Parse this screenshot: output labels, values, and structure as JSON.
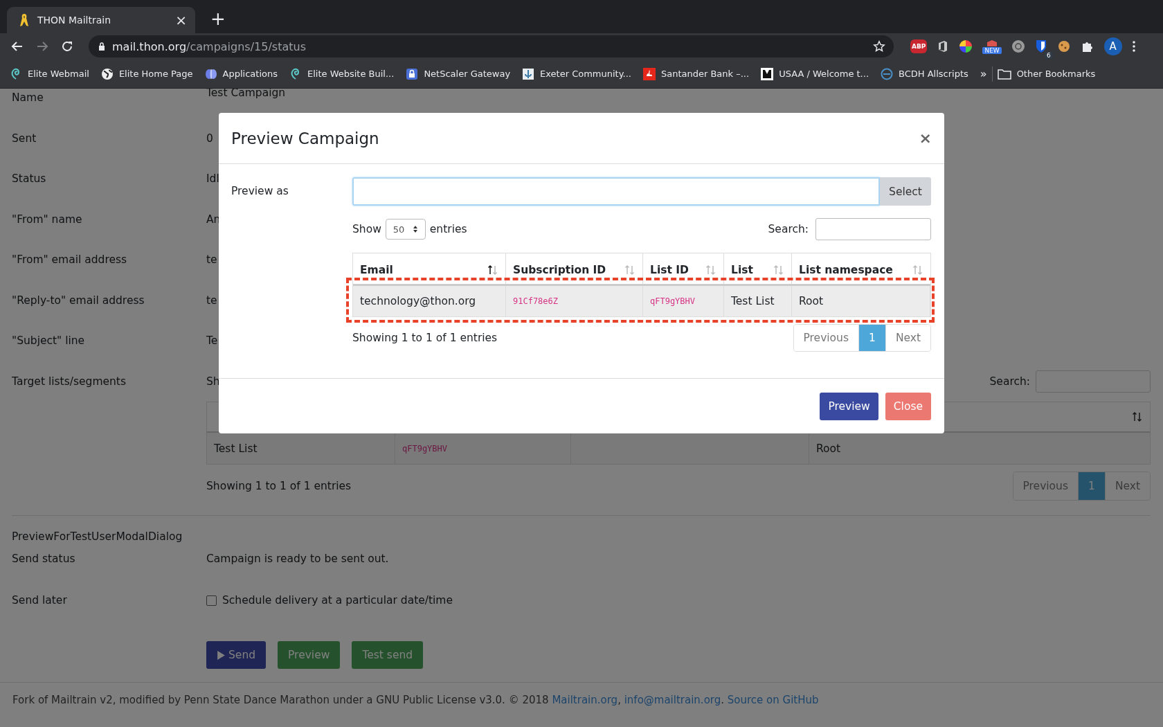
{
  "browser": {
    "tab_title": "THON Mailtrain",
    "tab_close": "×",
    "new_tab": "+",
    "url_host": "mail.thon.org",
    "url_path": "/campaigns/15/status",
    "bookmarks": [
      {
        "label": "Elite Webmail"
      },
      {
        "label": "Elite Home Page"
      },
      {
        "label": "Applications"
      },
      {
        "label": "Elite Website Buil..."
      },
      {
        "label": "NetScaler Gateway"
      },
      {
        "label": "Exeter Community..."
      },
      {
        "label": "Santander Bank –..."
      },
      {
        "label": "USAA / Welcome t..."
      },
      {
        "label": "BCDH Allscripts"
      }
    ],
    "bookmarks_overflow": "»",
    "other_bookmarks": "Other Bookmarks",
    "abp_label": "ABP",
    "new_badge": "NEW",
    "count_badge": "6",
    "avatar": "A"
  },
  "page": {
    "fields": [
      {
        "label": "Name",
        "value": "Test Campaign"
      },
      {
        "label": "Sent",
        "value": "0"
      },
      {
        "label": "Status",
        "value": "Idl"
      },
      {
        "label": "\"From\" name",
        "value": "An"
      },
      {
        "label": "\"From\" email address",
        "value": "te"
      },
      {
        "label": "\"Reply-to\" email address",
        "value": "te"
      },
      {
        "label": "\"Subject\" line",
        "value": "Te"
      },
      {
        "label": "Target lists/segments",
        "value": "Sh"
      }
    ],
    "targets": {
      "search_label": "Search:",
      "rows": [
        {
          "cells": [
            {
              "text": "Test List",
              "kind": "text"
            },
            {
              "text": "qFT9gYBHV",
              "kind": "code"
            },
            {
              "kind": "empty"
            },
            {
              "text": "Root",
              "kind": "text"
            }
          ]
        }
      ],
      "info": "Showing 1 to 1 of 1 entries",
      "pagination": [
        {
          "label": "Previous",
          "selected": false
        },
        {
          "label": "1",
          "selected": true
        },
        {
          "label": "Next",
          "selected": false
        }
      ]
    },
    "dialog_name": "PreviewForTestUserModalDialog",
    "send_status_label": "Send status",
    "send_status": "Campaign is ready to be sent out.",
    "send_later_label": "Send later",
    "schedule": {
      "label": "Schedule delivery at a particular date/time",
      "checked": false
    },
    "buttons": [
      {
        "label": "Send",
        "kind": "send"
      },
      {
        "label": "Preview",
        "kind": "success"
      },
      {
        "label": "Test send",
        "kind": "success"
      }
    ],
    "footer": {
      "text": "Fork of Mailtrain v2, modified by Penn State Dance Marathon under a GNU Public License v3.0. © 2018",
      "links": [
        {
          "text": "Mailtrain.org"
        },
        {
          "text": "info@mailtrain.org",
          "before": ","
        },
        {
          "text": "Source on GitHub",
          "before": "."
        }
      ]
    }
  },
  "modal": {
    "title": "Preview Campaign",
    "close": "×",
    "preview_as_label": "Preview as",
    "select_button": "Select",
    "show_label": "Show",
    "page_size": "50",
    "entries_label": "entries",
    "search_label": "Search:",
    "columns": [
      {
        "label": "Email",
        "sorted": true
      },
      {
        "label": "Subscription ID",
        "sorted": false
      },
      {
        "label": "List ID",
        "sorted": false
      },
      {
        "label": "List",
        "sorted": false
      },
      {
        "label": "List namespace",
        "sorted": false
      }
    ],
    "rows": [
      {
        "highlighted": true,
        "cells": [
          {
            "text": "technology@thon.org",
            "kind": "text"
          },
          {
            "text": "91Cf78e6Z",
            "kind": "code"
          },
          {
            "text": "qFT9gYBHV",
            "kind": "code"
          },
          {
            "text": "Test List",
            "kind": "text"
          },
          {
            "text": "Root",
            "kind": "text"
          }
        ]
      }
    ],
    "info": "Showing 1 to 1 of 1 entries",
    "pagination": [
      {
        "label": "Previous",
        "selected": false
      },
      {
        "label": "1",
        "selected": true
      },
      {
        "label": "Next",
        "selected": false
      }
    ],
    "buttons": [
      {
        "label": "Preview",
        "kind": "primary"
      },
      {
        "label": "Close",
        "kind": "danger"
      }
    ]
  }
}
